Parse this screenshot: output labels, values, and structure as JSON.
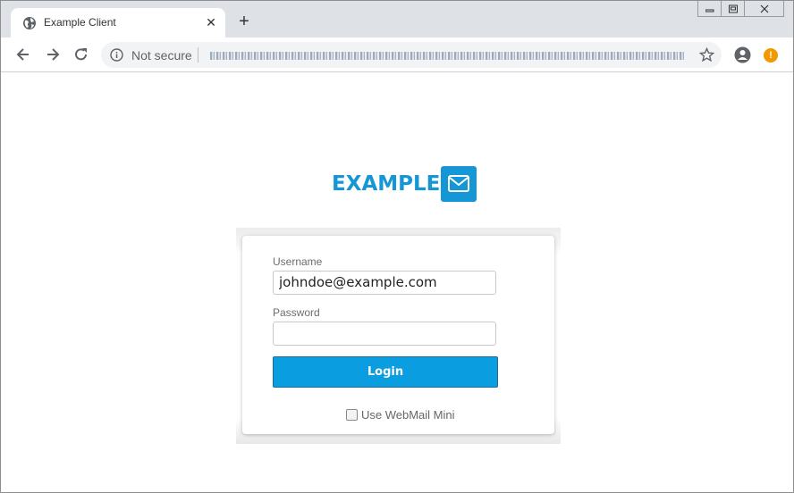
{
  "browser": {
    "tab": {
      "title": "Example Client",
      "close_glyph": "✕"
    },
    "new_tab_glyph": "+",
    "security_label": "Not secure",
    "alert_glyph": "!"
  },
  "login": {
    "logo_text": "EXAMPLE",
    "username_label": "Username",
    "username_value": "johndoe@example.com",
    "password_label": "Password",
    "password_value": "",
    "login_button": "Login",
    "webmail_mini_label": "Use WebMail Mini",
    "webmail_mini_checked": false
  },
  "colors": {
    "accent": "#1597d5",
    "button": "#0a9de0",
    "alert": "#f29900"
  },
  "icons": [
    "globe-icon",
    "close-icon",
    "plus-icon",
    "back-icon",
    "forward-icon",
    "reload-icon",
    "info-icon",
    "star-icon",
    "account-icon",
    "alert-icon",
    "mail-icon",
    "minimize-icon",
    "restore-icon",
    "window-close-icon"
  ]
}
